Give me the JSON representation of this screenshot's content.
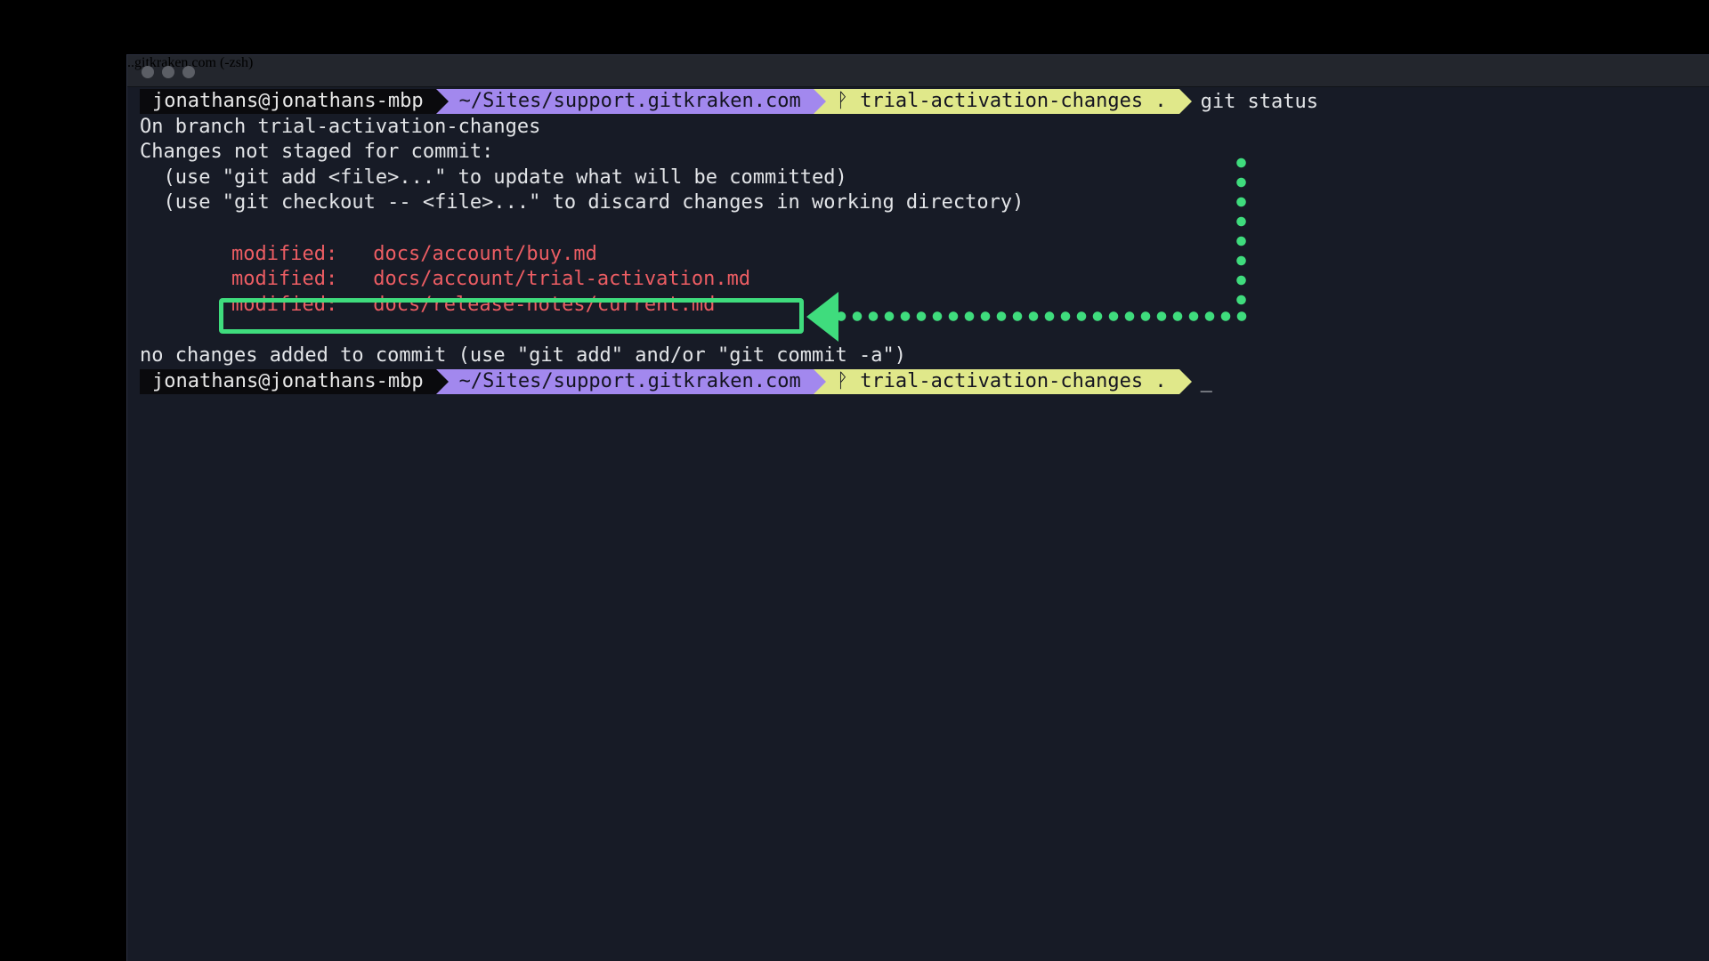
{
  "window": {
    "title": "..gitkraken.com (-zsh)"
  },
  "prompt": {
    "user": "jonathans@jonathans-mbp",
    "path": "~/Sites/support.gitkraken.com",
    "branch_icon": "git-branch-icon",
    "branch": "ᚹ trial-activation-changes .",
    "command": "git status",
    "cursor": "_"
  },
  "output": {
    "line1": "On branch trial-activation-changes",
    "line2": "Changes not staged for commit:",
    "line3": "  (use \"git add <file>...\" to update what will be committed)",
    "line4": "  (use \"git checkout -- <file>...\" to discard changes in working directory)",
    "modified": [
      {
        "status": "modified:",
        "file": "docs/account/buy.md"
      },
      {
        "status": "modified:",
        "file": "docs/account/trial-activation.md"
      },
      {
        "status": "modified:",
        "file": "docs/release-notes/current.md"
      }
    ],
    "footer": "no changes added to commit (use \"git add\" and/or \"git commit -a\")"
  },
  "colors": {
    "terminal_bg": "#171b26",
    "path_segment": "#a288ee",
    "branch_segment": "#e0e88a",
    "modified_text": "#ec5d63",
    "annotation": "#3fdc7d"
  }
}
